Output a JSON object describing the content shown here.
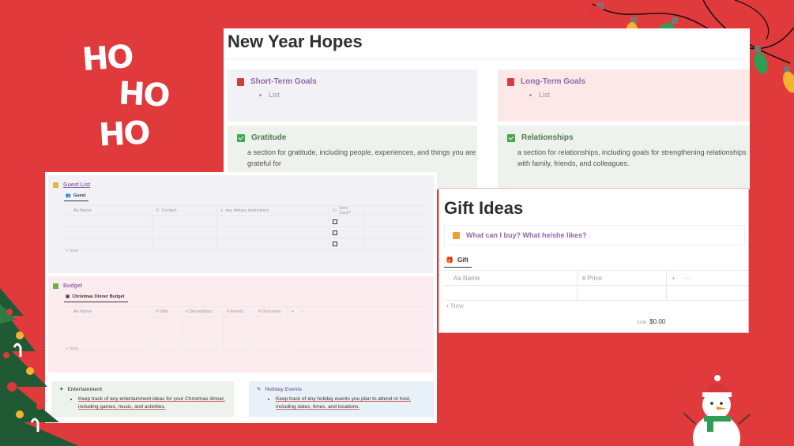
{
  "decor": {
    "ho": [
      "HO",
      "HO",
      "HO"
    ]
  },
  "new_year": {
    "title": "New Year Hopes",
    "short_term": {
      "title": "Short-Term Goals",
      "item": "List"
    },
    "long_term": {
      "title": "Long-Term Goals",
      "item": "List"
    },
    "gratitude": {
      "title": "Gratitude",
      "text": "a section for gratitude, including people, experiences, and things you are grateful for"
    },
    "relationships": {
      "title": "Relationships",
      "text": "a section for relationships, including goals for strengthening relationships with family, friends, and colleagues."
    }
  },
  "guest_list": {
    "title": "Guest List",
    "tab": "Guest",
    "columns": [
      "Aa Name",
      "Contact",
      "any dietary restrictions",
      "Sent Card?"
    ],
    "new_label": "+ New"
  },
  "budget": {
    "title": "Budget",
    "tab": "Christmas Dinner Budget",
    "columns": [
      "Aa Name",
      "# Gifts",
      "# Decorations",
      "# Events",
      "# Groceries"
    ],
    "new_label": "+ New"
  },
  "entertainment": {
    "title": "Entertainment",
    "text": "Keep track of any entertainment ideas for your Christmas dinner, including games, music, and activities."
  },
  "holiday_events": {
    "title": "Holiday Events",
    "text": "Keep track of any holiday events you plan to attend or host, including dates, times, and locations."
  },
  "gift_ideas": {
    "title": "Gift Ideas",
    "callout": "What can I buy? What he/she likes?",
    "tab": "Gift",
    "col_name": "Aa Name",
    "col_price": "# Price",
    "new_label": "+ New",
    "sum_label": "SUM",
    "sum_value": "$0.00"
  },
  "colors": {
    "background": "#e03a3c",
    "short_term_bg": "#f1f1f6",
    "long_term_bg": "#fde8e8",
    "green_bg": "#edf2ec",
    "blue_bg": "#e8f1f7"
  }
}
